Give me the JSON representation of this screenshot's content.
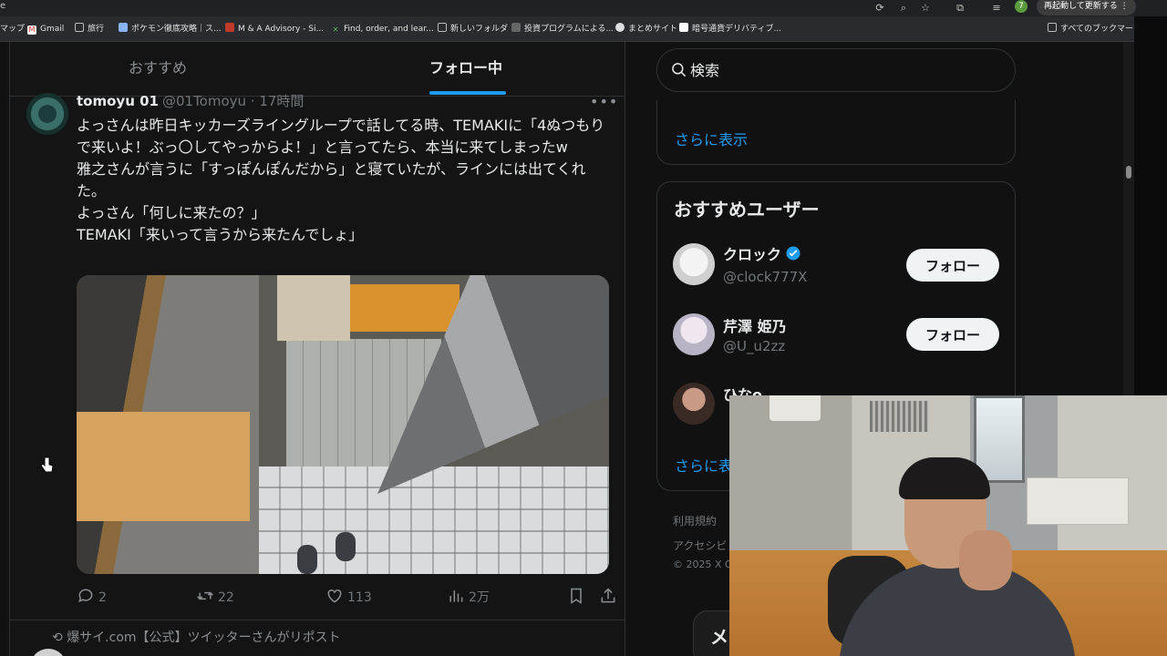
{
  "browser": {
    "cut_text": "e",
    "restart_label": "再起動して更新する",
    "profile_initial": "7",
    "bookmarks": [
      {
        "label": "マップ"
      },
      {
        "label": "Gmail"
      },
      {
        "label": "旅行"
      },
      {
        "label": "ポケモン徹底攻略｜ス..."
      },
      {
        "label": "M & A Advisory - Si..."
      },
      {
        "label": "Find, order, and lear..."
      },
      {
        "label": "新しいフォルダ"
      },
      {
        "label": "投資プログラムによる..."
      },
      {
        "label": "まとめサイト"
      },
      {
        "label": "暗号通貨デリバティブ..."
      },
      {
        "label": "すべてのブックマーク"
      }
    ]
  },
  "timeline": {
    "tabs": [
      {
        "label": "おすすめ"
      },
      {
        "label": "フォロー中"
      }
    ],
    "tweet": {
      "name": "tomoyu 01",
      "handle_time": "@01Tomoyu · 17時間",
      "body": "よっさんは昨日キッカーズライングループで話してる時、TEMAKIに「4ぬつもりで来いよ！ぶっ〇してやっからよ！」と言ってたら、本当に来てしまったw\n雅之さんが言うに「すっぽんぽんだから」と寝ていたが、ラインには出てくれた。\nよっさん「何しに来たの？」\nTEMAKI「来いって言うから来たんでしょ」",
      "replies": "2",
      "reposts": "22",
      "likes": "113",
      "views": "2万"
    },
    "next": {
      "repost_text": "爆サイ.com【公式】ツイッターさんがリポスト"
    }
  },
  "sidebar": {
    "search_placeholder": "検索",
    "show_more": "さらに表示",
    "suggest_title": "おすすめユーザー",
    "follow_label": "フォロー",
    "users": [
      {
        "name": "クロック",
        "handle": "@clock777X"
      },
      {
        "name": "芹澤 姫乃",
        "handle": "@U_u2zz"
      },
      {
        "name": "ひなo",
        "handle": ""
      }
    ],
    "show_more_2": "さらに表",
    "footer": [
      "利用規約",
      "アクセシビ",
      "© 2025 X C"
    ],
    "messages_fab": "メ"
  },
  "colors": {
    "accent": "#1d9bf0",
    "background": "#141414",
    "text": "#e7e9ea",
    "muted": "#71767b"
  }
}
